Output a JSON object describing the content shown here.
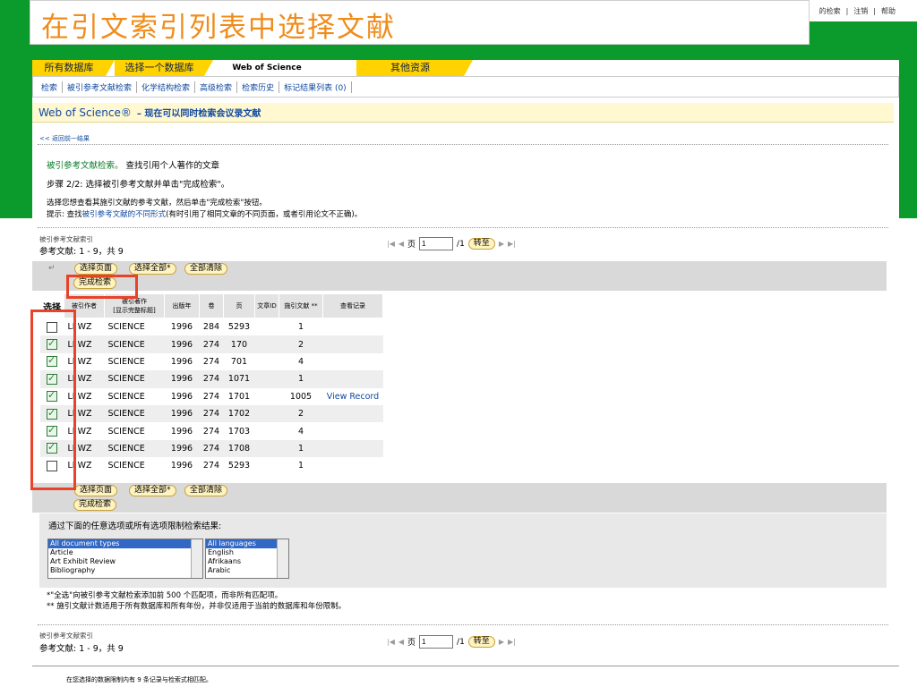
{
  "slide_title": "在引文索引列表中选择文献",
  "top_links": [
    "的检索",
    "注销",
    "帮助"
  ],
  "tabs": [
    "所有数据库",
    "选择一个数据库",
    "Web of Science",
    "其他资源"
  ],
  "subnav": [
    "检索",
    "被引参考文献检索",
    "化学结构检索",
    "高级检索",
    "检索历史",
    "标记结果列表 (0)"
  ],
  "wos": {
    "title": "Web of Science®",
    "subtitle": "– 现在可以同时检索会议录文献"
  },
  "back_link": "<< 返回前一结果",
  "intro": {
    "heading_link": "被引参考文献检索。",
    "heading_rest": "查找引用个人著作的文章",
    "step": "步骤 2/2: 选择被引参考文献并单击\"完成检索\"。",
    "line1": "选择您想查看其施引文献的参考文献，然后单击\"完成检索\"按钮。",
    "hint_prefix": "提示: 查找",
    "hint_link": "被引参考文献的不同形式",
    "hint_suffix": "(有时引用了相同文章的不同页面，或者引用论文不正确)。"
  },
  "index": {
    "label1": "被引参考文献索引",
    "label2": "参考文献: 1 - 9，共 9"
  },
  "pager": {
    "page_label": "页",
    "page_value": "1",
    "of": "/1",
    "go": "转至"
  },
  "buttons": {
    "select_page": "选择页面",
    "select_all": "选择全部*",
    "clear_all": "全部清除",
    "finish": "完成检索"
  },
  "columns": [
    "选择",
    "被引作者",
    "被引著作\n[显示完整标题]",
    "出版年",
    "卷",
    "页",
    "文章ID",
    "施引文献 **",
    "查看记录"
  ],
  "rows": [
    {
      "checked": false,
      "author": "LI WZ",
      "work": "SCIENCE",
      "year": "1996",
      "vol": "284",
      "page": "5293",
      "id": "",
      "cites": "1",
      "view": ""
    },
    {
      "checked": true,
      "author": "LI WZ",
      "work": "SCIENCE",
      "year": "1996",
      "vol": "274",
      "page": "170",
      "id": "",
      "cites": "2",
      "view": ""
    },
    {
      "checked": true,
      "author": "LI WZ",
      "work": "SCIENCE",
      "year": "1996",
      "vol": "274",
      "page": "701",
      "id": "",
      "cites": "4",
      "view": ""
    },
    {
      "checked": true,
      "author": "LI WZ",
      "work": "SCIENCE",
      "year": "1996",
      "vol": "274",
      "page": "1071",
      "id": "",
      "cites": "1",
      "view": ""
    },
    {
      "checked": true,
      "author": "LI WZ",
      "work": "SCIENCE",
      "year": "1996",
      "vol": "274",
      "page": "1701",
      "id": "",
      "cites": "1005",
      "view": "View Record"
    },
    {
      "checked": true,
      "author": "LI WZ",
      "work": "SCIENCE",
      "year": "1996",
      "vol": "274",
      "page": "1702",
      "id": "",
      "cites": "2",
      "view": ""
    },
    {
      "checked": true,
      "author": "LI WZ",
      "work": "SCIENCE",
      "year": "1996",
      "vol": "274",
      "page": "1703",
      "id": "",
      "cites": "4",
      "view": ""
    },
    {
      "checked": true,
      "author": "LI WZ",
      "work": "SCIENCE",
      "year": "1996",
      "vol": "274",
      "page": "1708",
      "id": "",
      "cites": "1",
      "view": ""
    },
    {
      "checked": false,
      "author": "LI WZ",
      "work": "SCIENCE",
      "year": "1996",
      "vol": "274",
      "page": "5293",
      "id": "",
      "cites": "1",
      "view": ""
    }
  ],
  "restrict": {
    "title": "通过下面的任意选项或所有选项限制检索结果:",
    "doc_types": [
      "All document types",
      "Article",
      "Art Exhibit Review",
      "Bibliography"
    ],
    "languages": [
      "All languages",
      "English",
      "Afrikaans",
      "Arabic"
    ]
  },
  "notes": [
    "*\"全选\"向被引参考文献检索添加前 500 个匹配项，而非所有匹配项。",
    "** 施引文献计数适用于所有数据库和所有年份，并非仅适用于当前的数据库和年份限制。"
  ],
  "footer": "在您选择的数据限制内有 9 条记录与检索式相匹配。"
}
